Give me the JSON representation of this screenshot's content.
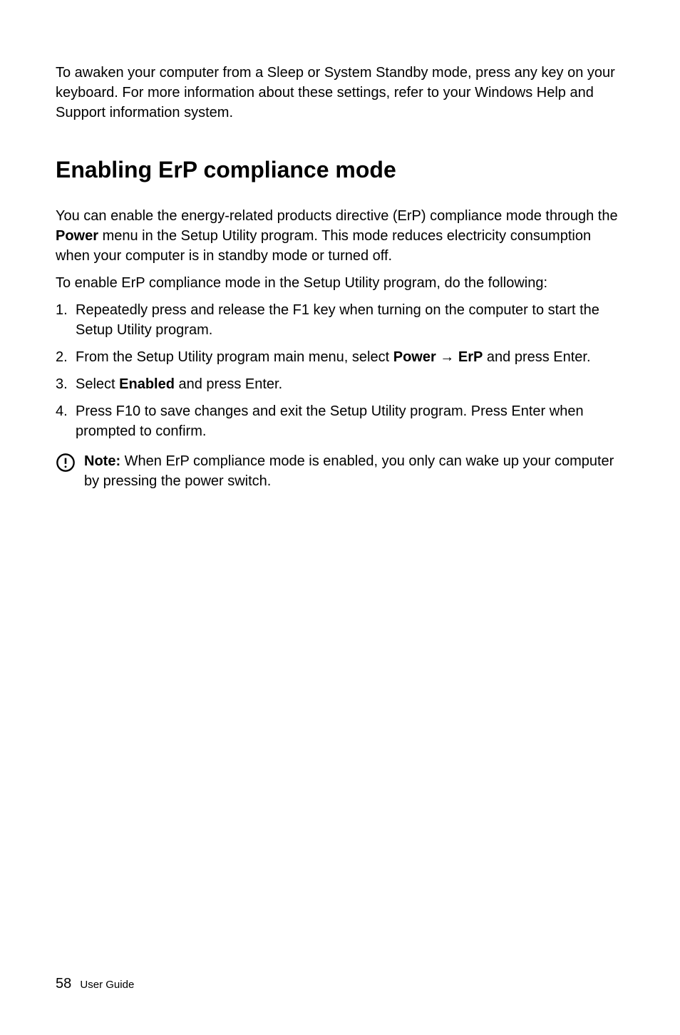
{
  "intro": "To awaken your computer from a Sleep or System Standby mode, press any key on your keyboard. For more information about these settings, refer to your Windows Help and Support information system.",
  "heading": "Enabling ErP compliance mode",
  "para1_a": "You can enable the energy-related products directive (ErP) compliance mode through the ",
  "para1_bold": "Power",
  "para1_b": " menu in the Setup Utility program. This mode reduces electricity consumption when your computer is in standby mode or turned off.",
  "para2": "To enable ErP compliance mode in the Setup Utility program, do the following:",
  "list": {
    "item1_num": "1.",
    "item1_text": "Repeatedly press and release the F1 key when turning on the computer to start the Setup Utility program.",
    "item2_num": "2.",
    "item2_a": "From the Setup Utility program main menu, select ",
    "item2_bold": "Power → ErP",
    "item2_b": " and press Enter.",
    "item3_num": "3.",
    "item3_a": "Select ",
    "item3_bold": "Enabled",
    "item3_b": " and press Enter.",
    "item4_num": "4.",
    "item4_text": "Press F10 to save changes and exit the Setup Utility program. Press Enter when prompted to confirm."
  },
  "note_label": "Note:",
  "note_text": " When ErP compliance mode is enabled, you only can wake up your computer by pressing the power switch.",
  "footer_page": "58",
  "footer_label": "User Guide"
}
